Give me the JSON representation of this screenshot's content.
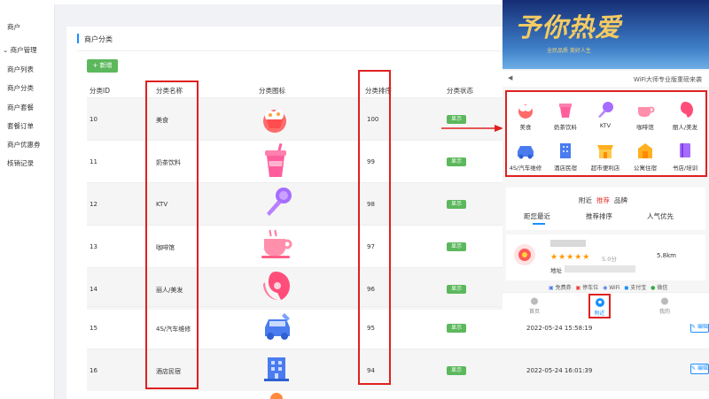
{
  "sidebar": {
    "items": [
      {
        "label": "商户"
      },
      {
        "label": "⌄ 商户管理"
      },
      {
        "label": "商户列表"
      },
      {
        "label": "商户分类"
      },
      {
        "label": "商户套餐"
      },
      {
        "label": "套餐订单"
      },
      {
        "label": "商户优惠券"
      },
      {
        "label": "核销记录"
      }
    ]
  },
  "page": {
    "title": "商户分类",
    "add_label": "+ 新增"
  },
  "table": {
    "headers": [
      "分类ID",
      "分类名称",
      "分类图标",
      "分类排序",
      "分类状态"
    ],
    "rows": [
      {
        "id": "10",
        "name": "美食",
        "icon": "food-icon",
        "sort": "100",
        "status": "显示",
        "date": ""
      },
      {
        "id": "11",
        "name": "奶茶饮料",
        "icon": "milk-tea-icon",
        "sort": "99",
        "status": "显示",
        "date": ""
      },
      {
        "id": "12",
        "name": "KTV",
        "icon": "microphone-icon",
        "sort": "98",
        "status": "显示",
        "date": ""
      },
      {
        "id": "13",
        "name": "咖啡馆",
        "icon": "coffee-icon",
        "sort": "97",
        "status": "显示",
        "date": ""
      },
      {
        "id": "14",
        "name": "丽人/美发",
        "icon": "beauty-icon",
        "sort": "96",
        "status": "显示",
        "date": ""
      },
      {
        "id": "15",
        "name": "4S/汽车维修",
        "icon": "car-repair-icon",
        "sort": "95",
        "status": "显示",
        "date": "2022-05-24 15:58:19"
      },
      {
        "id": "16",
        "name": "酒店民宿",
        "icon": "hotel-icon",
        "sort": "94",
        "status": "显示",
        "date": "2022-05-24 16:01:39"
      }
    ],
    "edit_label": "编辑"
  },
  "phone": {
    "banner_title": "予你热爱",
    "banner_sub": "全民品质 美好人生",
    "notice": "WiFi大师专业版重磅来袭",
    "grid": [
      {
        "label": "美食",
        "icon": "food-icon"
      },
      {
        "label": "奶茶饮料",
        "icon": "milk-tea-icon"
      },
      {
        "label": "KTV",
        "icon": "microphone-icon"
      },
      {
        "label": "咖啡馆",
        "icon": "coffee-icon"
      },
      {
        "label": "丽人/美发",
        "icon": "beauty-icon"
      },
      {
        "label": "4S/汽车维修",
        "icon": "car-repair-icon"
      },
      {
        "label": "酒店民宿",
        "icon": "hotel-icon"
      },
      {
        "label": "超市便利店",
        "icon": "store-icon"
      },
      {
        "label": "公寓住宿",
        "icon": "apartment-icon"
      },
      {
        "label": "书店/培训",
        "icon": "book-icon"
      }
    ],
    "nearby": {
      "t1": "附近",
      "t2": "推荐",
      "t3": "品牌",
      "sorts": [
        "距您最近",
        "推荐排序",
        "人气优先"
      ]
    },
    "shop": {
      "score": "5.0分",
      "distance": "5.8km",
      "addr_label": "地址"
    },
    "features": [
      "免费券",
      "停车位",
      "WiFi",
      "支付宝",
      "微信"
    ],
    "tabs": [
      "首页",
      "附近",
      "我的"
    ]
  },
  "colors": {
    "accent": "#1890ff",
    "green": "#5cb85c",
    "highlight": "#e02020"
  }
}
